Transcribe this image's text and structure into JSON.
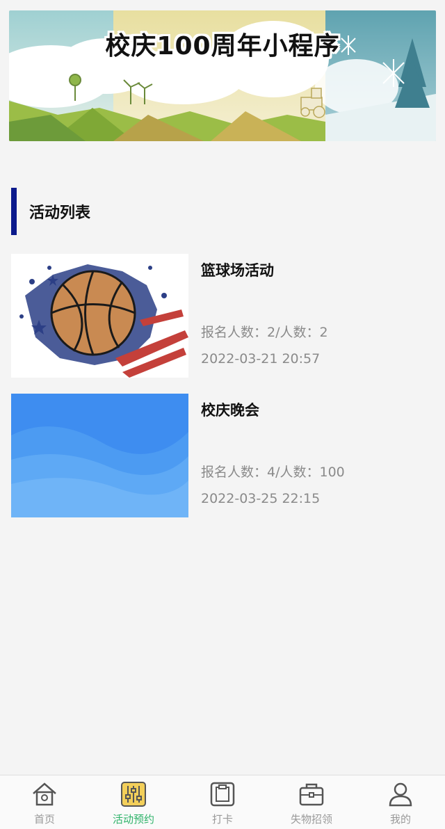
{
  "banner": {
    "title": "校庆100周年小程序"
  },
  "section": {
    "title": "活动列表"
  },
  "activities": [
    {
      "title": "篮球场活动",
      "count": "报名人数：2/人数：2",
      "date": "2022-03-21 20:57",
      "thumb": "basketball-image"
    },
    {
      "title": "校庆晚会",
      "count": "报名人数：4/人数：100",
      "date": "2022-03-25 22:15",
      "thumb": "blue-wave-image"
    }
  ],
  "tabbar": {
    "items": [
      {
        "label": "首页",
        "icon": "home-icon"
      },
      {
        "label": "活动预约",
        "icon": "sliders-icon",
        "active": true
      },
      {
        "label": "打卡",
        "icon": "clipboard-icon"
      },
      {
        "label": "失物招领",
        "icon": "bag-icon"
      },
      {
        "label": "我的",
        "icon": "user-icon"
      }
    ]
  },
  "colors": {
    "accent": "#2fb36a",
    "section_bar": "#0c1a8c",
    "muted_text": "#8a8a8a"
  }
}
